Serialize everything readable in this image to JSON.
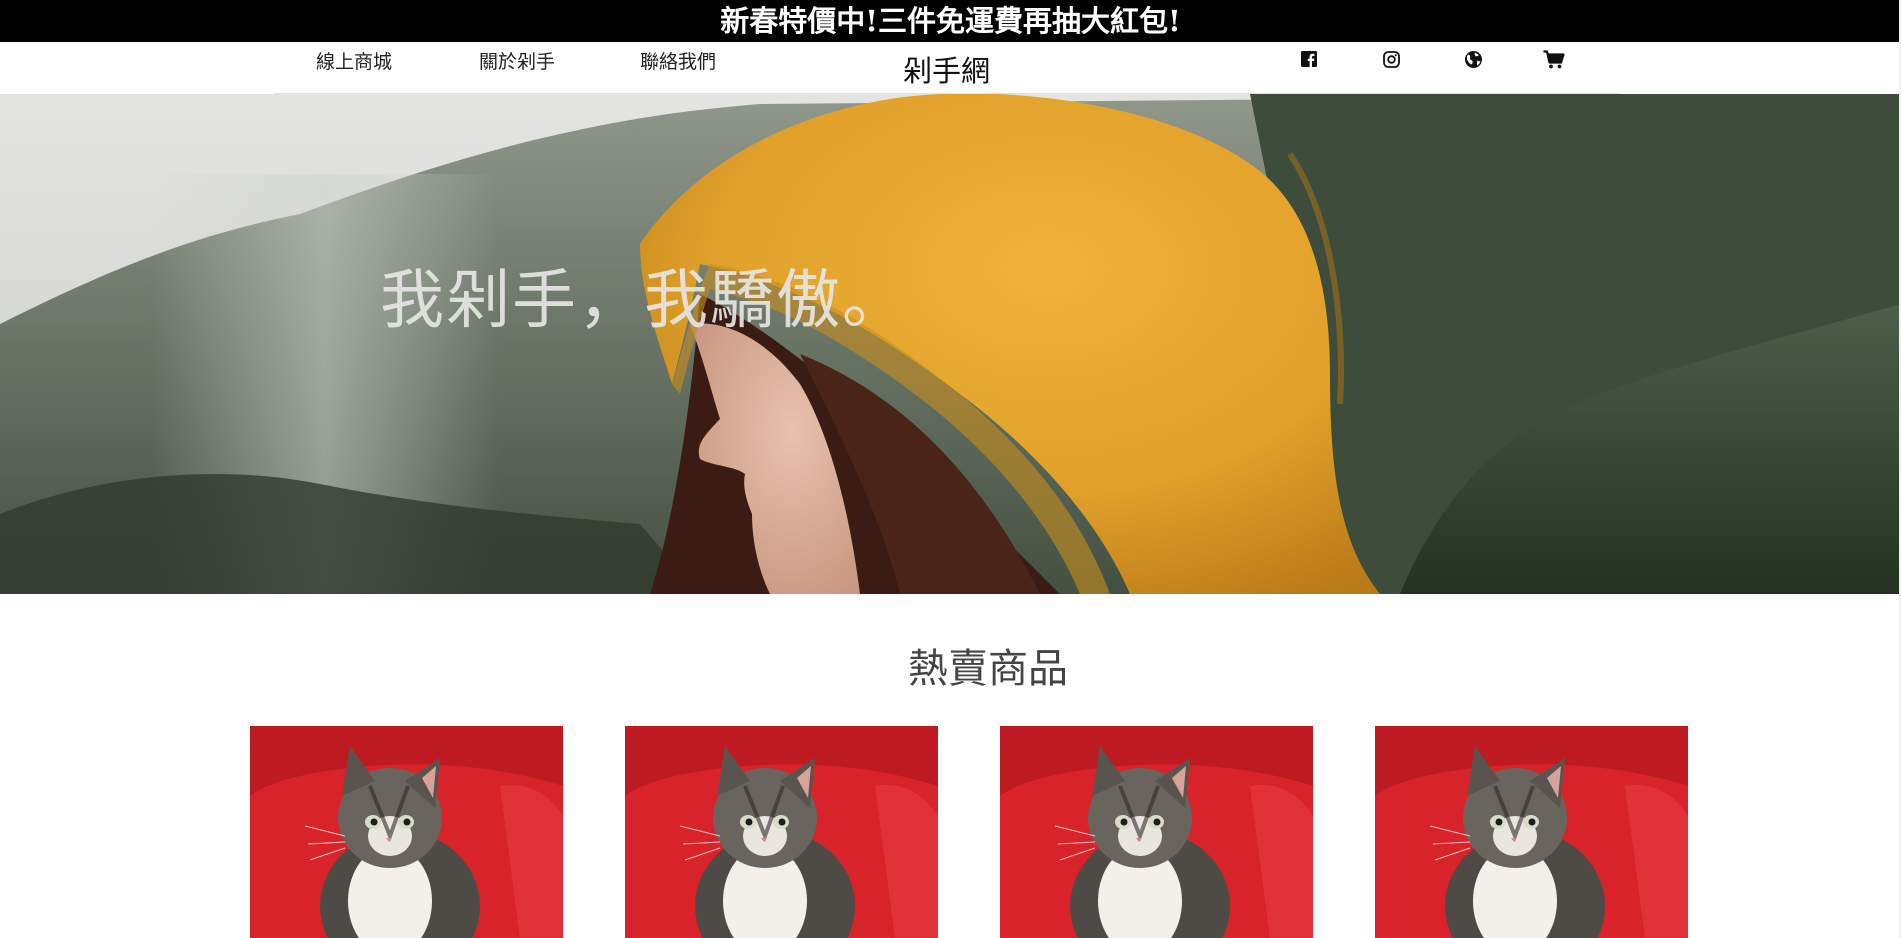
{
  "promo": {
    "text": "新春特價中!三件免運費再抽大紅包!"
  },
  "nav": {
    "links": [
      {
        "label": "線上商城"
      },
      {
        "label": "關於剁手"
      },
      {
        "label": "聯絡我們"
      }
    ],
    "brand": "剁手網",
    "icons": [
      "facebook-icon",
      "instagram-icon",
      "globe-icon",
      "cart-icon"
    ]
  },
  "hero": {
    "title": "我剁手，我驕傲。"
  },
  "hot_products": {
    "title": "熱賣商品",
    "items": [
      {
        "image": "kitten-photo"
      },
      {
        "image": "kitten-photo"
      },
      {
        "image": "kitten-photo"
      },
      {
        "image": "kitten-photo"
      }
    ]
  },
  "colors": {
    "promo_bg": "#000000",
    "promo_text": "#ffffff",
    "hood": "#e7a52a",
    "product_bg": "#d8232b"
  }
}
